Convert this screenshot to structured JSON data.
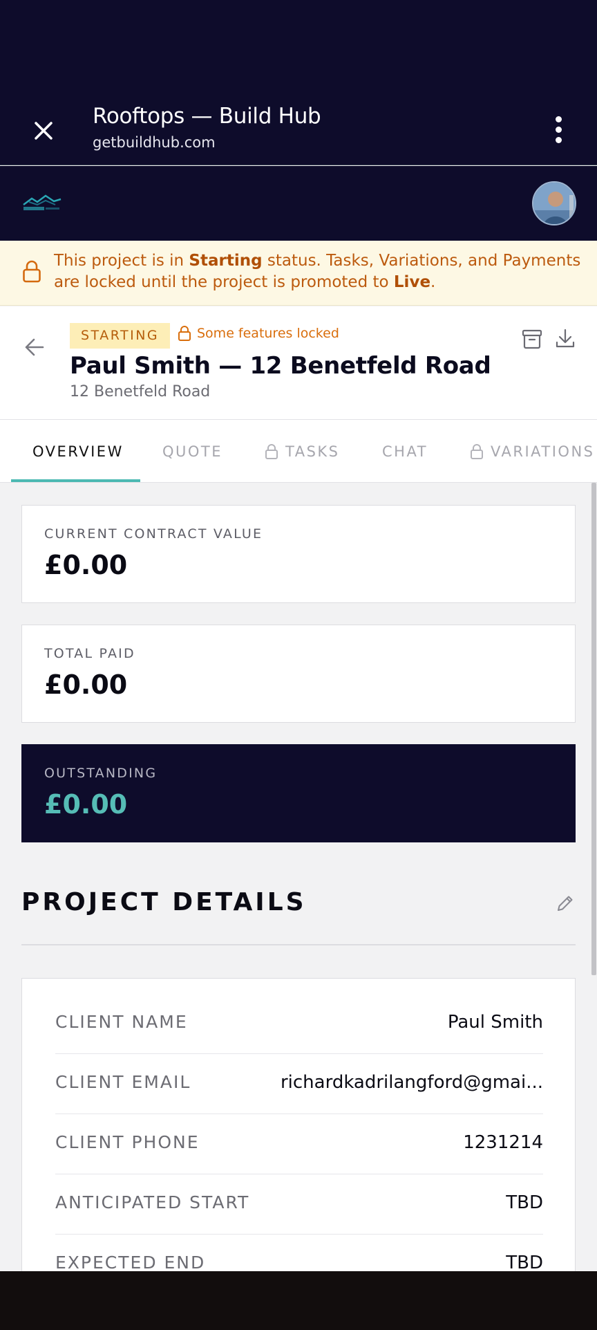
{
  "browser": {
    "title": "Rooftops — Build Hub",
    "url": "getbuildhub.com"
  },
  "banner": {
    "pre": "This project is in ",
    "status_word": "Starting",
    "mid": " status. Tasks, Variations, and Payments are locked until the project is promoted to ",
    "target_word": "Live",
    "post": "."
  },
  "project": {
    "status_badge": "STARTING",
    "locked_note": "Some features locked",
    "title": "Paul Smith — 12 Benetfeld Road",
    "address": "12 Benetfeld Road"
  },
  "tabs": [
    {
      "label": "OVERVIEW",
      "active": true,
      "locked": false
    },
    {
      "label": "QUOTE",
      "active": false,
      "locked": false
    },
    {
      "label": "TASKS",
      "active": false,
      "locked": true
    },
    {
      "label": "CHAT",
      "active": false,
      "locked": false
    },
    {
      "label": "VARIATIONS",
      "active": false,
      "locked": true
    }
  ],
  "stats": {
    "contract": {
      "label": "CURRENT CONTRACT VALUE",
      "value": "£0.00"
    },
    "paid": {
      "label": "TOTAL PAID",
      "value": "£0.00"
    },
    "outstanding": {
      "label": "OUTSTANDING",
      "value": "£0.00"
    }
  },
  "details": {
    "title": "PROJECT DETAILS",
    "rows": [
      {
        "label": "CLIENT NAME",
        "value": "Paul Smith"
      },
      {
        "label": "CLIENT EMAIL",
        "value": "richardkadrilangford@gmai..."
      },
      {
        "label": "CLIENT PHONE",
        "value": "1231214"
      },
      {
        "label": "ANTICIPATED START",
        "value": "TBD"
      },
      {
        "label": "EXPECTED END",
        "value": "TBD"
      }
    ]
  },
  "colors": {
    "navy": "#0e0c2b",
    "teal": "#4cb9b2",
    "warning_text": "#bc5a0e",
    "badge_bg": "#fdeeb7"
  }
}
